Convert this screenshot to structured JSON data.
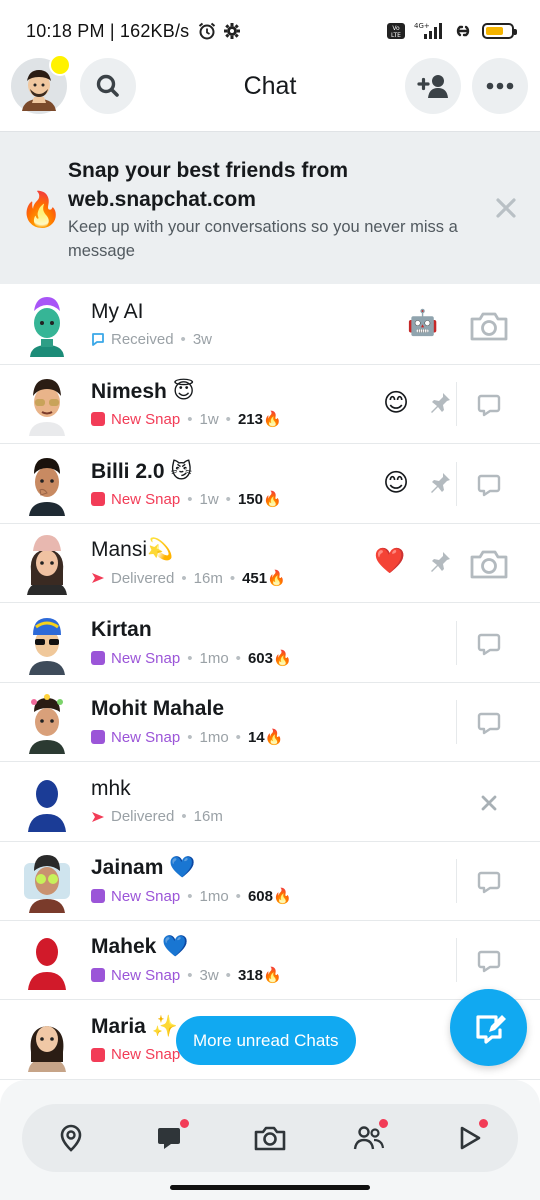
{
  "status_bar": {
    "time": "10:18 PM | 162KB/s",
    "network_label": "4G+",
    "volte_label": "Vo LTE"
  },
  "header": {
    "title": "Chat"
  },
  "banner": {
    "title": "Snap your best friends from web.snapchat.com",
    "subtitle": "Keep up with your conversations so you never miss a message",
    "icon": "🔥"
  },
  "chats": [
    {
      "name": "My AI",
      "bold": false,
      "status_icon": "received",
      "status": "Received",
      "time": "3w",
      "streak": "",
      "emoji": "🤖",
      "pinned": false,
      "action": "camera",
      "divider": false
    },
    {
      "name": "Nimesh 😇",
      "bold": true,
      "status_icon": "red-square",
      "status": "New Snap",
      "time": "1w",
      "streak": "213🔥",
      "emoji": "😊",
      "pinned": true,
      "action": "chat",
      "divider": true
    },
    {
      "name": "Billi 2.0 😼",
      "bold": true,
      "status_icon": "red-square",
      "status": "New Snap",
      "time": "1w",
      "streak": "150🔥",
      "emoji": "😊",
      "pinned": true,
      "action": "chat",
      "divider": true
    },
    {
      "name": "Mansi💫",
      "bold": false,
      "status_icon": "red-arrow",
      "status": "Delivered",
      "time": "16m",
      "streak": "451🔥",
      "emoji": "❤️",
      "pinned": true,
      "action": "camera",
      "divider": false
    },
    {
      "name": "Kirtan",
      "bold": true,
      "status_icon": "purple-square",
      "status": "New Snap",
      "time": "1mo",
      "streak": "603🔥",
      "emoji": "",
      "pinned": false,
      "action": "chat",
      "divider": true
    },
    {
      "name": "Mohit Mahale",
      "bold": true,
      "status_icon": "purple-square",
      "status": "New Snap",
      "time": "1mo",
      "streak": "14🔥",
      "emoji": "",
      "pinned": false,
      "action": "chat",
      "divider": true
    },
    {
      "name": "mhk",
      "bold": false,
      "status_icon": "red-arrow",
      "status": "Delivered",
      "time": "16m",
      "streak": "",
      "emoji": "",
      "pinned": false,
      "action": "close",
      "divider": false
    },
    {
      "name": "Jainam 💙",
      "bold": true,
      "status_icon": "purple-square",
      "status": "New Snap",
      "time": "1mo",
      "streak": "608🔥",
      "emoji": "",
      "pinned": false,
      "action": "chat",
      "divider": true
    },
    {
      "name": "Mahek 💙",
      "bold": true,
      "status_icon": "purple-square",
      "status": "New Snap",
      "time": "3w",
      "streak": "318🔥",
      "emoji": "",
      "pinned": false,
      "action": "chat",
      "divider": true
    },
    {
      "name": "Maria ✨",
      "bold": true,
      "status_icon": "red-square",
      "status": "New Snap",
      "time": "",
      "streak": "",
      "emoji": "",
      "pinned": false,
      "action": "none",
      "divider": false
    }
  ],
  "floating": {
    "more_unread": "More unread Chats"
  },
  "nav": [
    {
      "key": "map",
      "badge": false
    },
    {
      "key": "chat",
      "badge": true
    },
    {
      "key": "camera",
      "badge": false
    },
    {
      "key": "stories",
      "badge": true
    },
    {
      "key": "spotlight",
      "badge": true
    }
  ],
  "colors": {
    "accent": "#11a9f1",
    "new_snap_red": "#f23c57",
    "new_snap_purple": "#9b55d8",
    "received_blue": "#3aa8e8"
  }
}
